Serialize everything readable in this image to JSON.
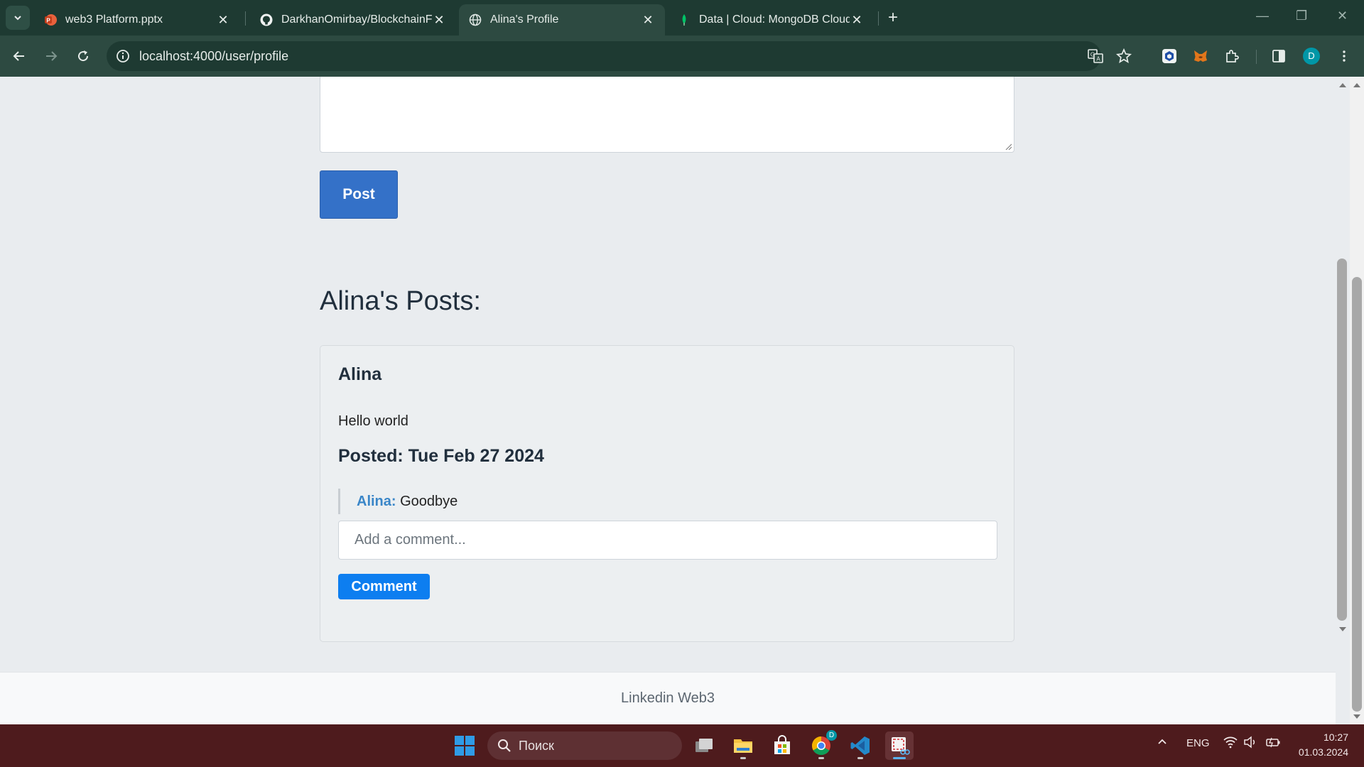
{
  "browser": {
    "tabs": [
      {
        "title": "web3 Platform.pptx",
        "icon": "powerpoint-icon",
        "active": false
      },
      {
        "title": "DarkhanOmirbay/BlockchainFinal",
        "icon": "github-icon",
        "active": false
      },
      {
        "title": "Alina's Profile",
        "icon": "globe-icon",
        "active": true
      },
      {
        "title": "Data | Cloud: MongoDB Cloud",
        "icon": "mongodb-leaf-icon",
        "active": false
      }
    ],
    "url": "localhost:4000/user/profile",
    "profile_initial": "D"
  },
  "page": {
    "post_button": "Post",
    "posts_heading": "Alina's Posts:",
    "posts": [
      {
        "author": "Alina",
        "content": "Hello world",
        "posted": "Posted: Tue Feb 27 2024",
        "comments": [
          {
            "author": "Alina:",
            "text": "Goodbye"
          }
        ],
        "comment_placeholder": "Add a comment...",
        "comment_button": "Comment"
      }
    ],
    "footer": "Linkedin Web3"
  },
  "taskbar": {
    "search_placeholder": "Поиск",
    "language": "ENG",
    "time": "10:27",
    "date": "01.03.2024",
    "chrome_badge": "D"
  },
  "colors": {
    "primary_button": "#3471c8",
    "comment_button": "#0d7ef0",
    "comment_author": "#3a86c8",
    "browser_frame": "#1e3a32",
    "taskbar": "#4e1b1d"
  }
}
